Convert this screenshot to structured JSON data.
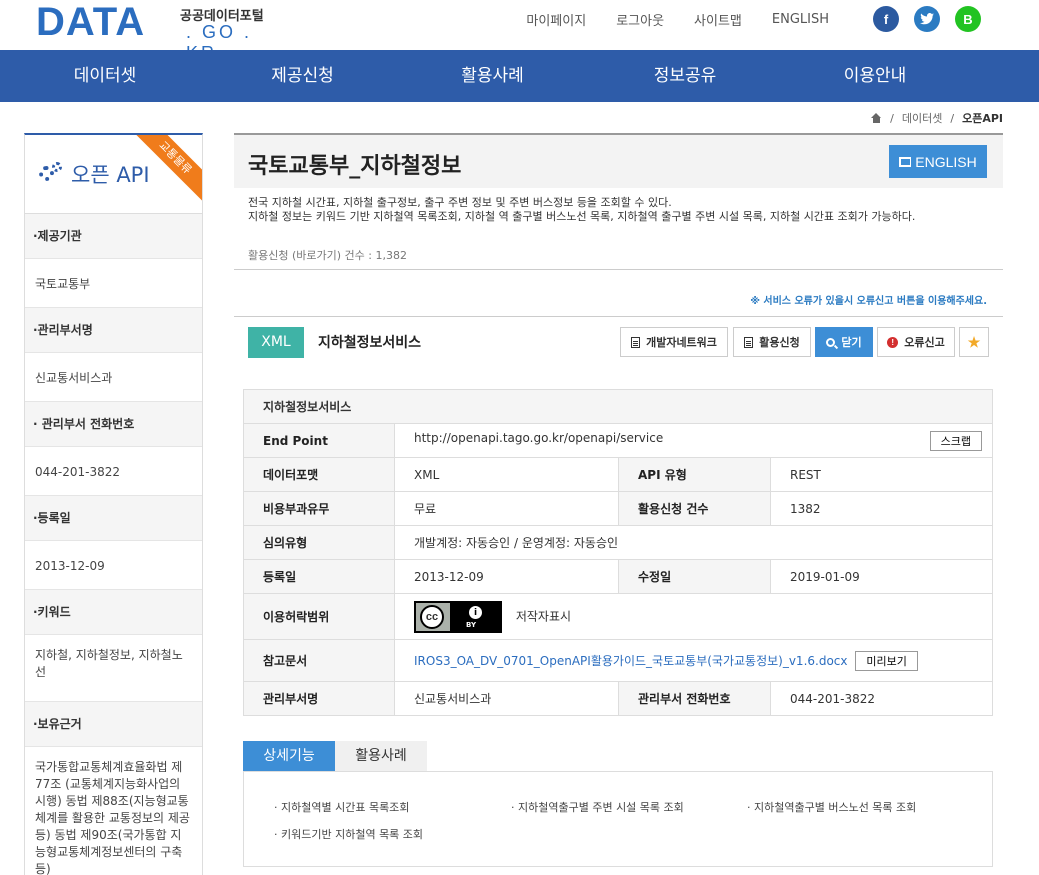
{
  "logo": {
    "wordmark": "DATA",
    "korean": "공공데이터포털",
    "domain": ". GO . KR"
  },
  "topnav": {
    "mypage": "마이페이지",
    "logout": "로그아웃",
    "sitemap": "사이트맵",
    "english": "ENGLISH"
  },
  "social": {
    "facebook": "f",
    "twitter": "t",
    "blog": "B"
  },
  "mainnav": [
    "데이터셋",
    "제공신청",
    "활용사례",
    "정보공유",
    "이용안내"
  ],
  "breadcrumb": {
    "sep1": "/",
    "level1": "데이터셋",
    "sep2": "/",
    "current": "오픈API"
  },
  "sidebar": {
    "title": "오픈 API",
    "ribbon": "교통물류",
    "sections": [
      {
        "label": "·제공기관",
        "value": "국토교통부"
      },
      {
        "label": "·관리부서명",
        "value": "신교통서비스과"
      },
      {
        "label": "· 관리부서 전화번호",
        "value": "044-201-3822"
      },
      {
        "label": "·등록일",
        "value": "2013-12-09"
      },
      {
        "label": "·키워드",
        "value": "지하철, 지하철정보, 지하철노선"
      },
      {
        "label": "·보유근거",
        "value": "국가통합교통체계효율화법 제77조 (교통체계지능화사업의 시행) 동법 제88조(지능형교통체계를 활용한 교통정보의 제공 등) 동법 제90조(국가통합 지능형교통체계정보센터의 구축 등)"
      }
    ]
  },
  "main": {
    "title": "국토교통부_지하철정보",
    "english_button": "ENGLISH",
    "description_1": "전국 지하철 시간표, 지하철 출구정보, 출구 주변 정보 및 주변 버스정보 등을 조회할 수 있다.",
    "description_2": "지하철 정보는 키워드 기반 지하철역 목록조회, 지하철 역 출구별 버스노선 목록, 지하철역 출구별 주변 시설 목록, 지하철 시간표 조회가 가능하다.",
    "stats": "활용신청 (바로가기) 건수 : 1,382",
    "notice": "※ 서비스 오류가 있을시 오류신고 버튼을 이용해주세요."
  },
  "service_bar": {
    "format_badge": "XML",
    "name": "지하철정보서비스",
    "buttons": {
      "dev_network": "개발자네트워크",
      "apply": "활용신청",
      "close": "닫기",
      "report": "오류신고"
    }
  },
  "info_table": {
    "header": "지하철정보서비스",
    "endpoint_label": "End Point",
    "endpoint_value": "http://openapi.tago.go.kr/openapi/service",
    "scrap_button": "스크랩",
    "format_label": "데이터포맷",
    "format_value": "XML",
    "api_type_label": "API 유형",
    "api_type_value": "REST",
    "cost_label": "비용부과유무",
    "cost_value": "무료",
    "apply_count_label": "활용신청 건수",
    "apply_count_value": "1382",
    "review_label": "심의유형",
    "review_value": "개발계정: 자동승인 / 운영계정: 자동승인",
    "reg_label": "등록일",
    "reg_value": "2013-12-09",
    "mod_label": "수정일",
    "mod_value": "2019-01-09",
    "license_label": "이용허락범위",
    "license_badge_cc": "cc",
    "license_badge_by": "BY",
    "license_value": "저작자표시",
    "ref_label": "참고문서",
    "ref_value": "IROS3_OA_DV_0701_OpenAPI활용가이드_국토교통부(국가교통정보)_v1.6.docx",
    "preview_button": "미리보기",
    "dept_label": "관리부서명",
    "dept_value": "신교통서비스과",
    "phone_label": "관리부서 전화번호",
    "phone_value": "044-201-3822"
  },
  "tabs": {
    "detail": "상세기능",
    "cases": "활용사례"
  },
  "functions": [
    "· 지하철역별 시간표 목록조회",
    "· 지하철역출구별 주변 시설 목록 조회",
    "· 지하철역출구별 버스노선 목록 조회",
    "· 키워드기반 지하철역 목록 조회"
  ]
}
